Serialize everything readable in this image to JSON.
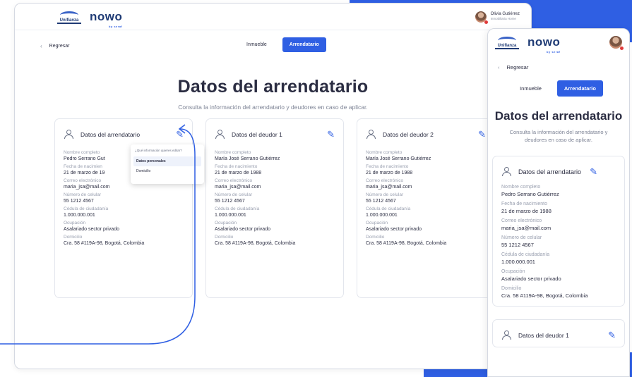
{
  "brand": {
    "unifianza": "Unifianza",
    "nowo": "nowo",
    "nowo_tag": "by seraf"
  },
  "user": {
    "name": "Olivia Gutiérrez",
    "role": "Inmobiliaria Home"
  },
  "nav": {
    "back": "Regresar",
    "tab_inmueble": "Inmueble",
    "tab_arrendatario": "Arrendatario"
  },
  "page": {
    "title": "Datos del arrendatario",
    "subtitle": "Consulta la información del arrendatario y deudores en caso de aplicar."
  },
  "labels": {
    "nombre": "Nombre completo",
    "fecha": "Fecha de nacimiento",
    "correo": "Correo electrónico",
    "celular": "Número de celular",
    "cedula": "Cédula de ciudadanía",
    "ocupacion": "Ocupación",
    "domicilio": "Domicilio"
  },
  "cards": [
    {
      "title": "Datos del arrendatario",
      "nombre_label": "Nombre completo",
      "nombre": "Pedro Serrano Gut",
      "fecha_label": "Fecha de nacimien",
      "fecha": "21 de marzo de 19",
      "correo": "maria_jsa@mail.com",
      "celular": "55 1212 4567",
      "cedula": "1.000.000.001",
      "ocupacion": "Asalariado sector privado",
      "domicilio": "Cra. 58 #119A-98, Bogotá, Colombia"
    },
    {
      "title": "Datos del deudor 1",
      "nombre": "María José Serrano Gutiérrez",
      "fecha": "21 de marzo de 1988",
      "correo": "maria_jsa@mail.com",
      "celular": "55 1212 4567",
      "cedula": "1.000.000.001",
      "ocupacion": "Asalariado sector privado",
      "domicilio": "Cra. 58 #119A-98, Bogotá, Colombia"
    },
    {
      "title": "Datos del deudor 2",
      "nombre": "María José Serrano Gutiérrez",
      "fecha": "21 de marzo de 1988",
      "correo": "maria_jsa@mail.com",
      "celular": "55 1212 4567",
      "cedula": "1.000.000.001",
      "ocupacion": "Asalariado sector privado",
      "domicilio": "Cra. 58 #119A-98, Bogotá, Colombia"
    }
  ],
  "dropdown": {
    "header": "¿Qué información quieres editar?",
    "item_personal": "Datos personales",
    "item_domicilio": "Domicilio"
  },
  "mobile": {
    "card1": {
      "title": "Datos del arrendatario",
      "nombre": "Pedro Serrano Gutiérrez",
      "fecha": "21 de marzo de 1988",
      "correo": "maria_jsa@mail.com",
      "celular": "55 1212 4567",
      "cedula": "1.000.000.001",
      "ocupacion": "Asalariado sector privado",
      "domicilio": "Cra. 58 #119A-98, Bogotá, Colombia"
    },
    "card2_title": "Datos del deudor 1"
  },
  "colors": {
    "primary": "#2f5fe3",
    "navy": "#1f3b75",
    "text": "#2b2d42",
    "muted": "#9aa0b0"
  },
  "icons": {
    "person": "person-icon",
    "edit": "pencil-icon",
    "back": "chevron-left-icon"
  }
}
